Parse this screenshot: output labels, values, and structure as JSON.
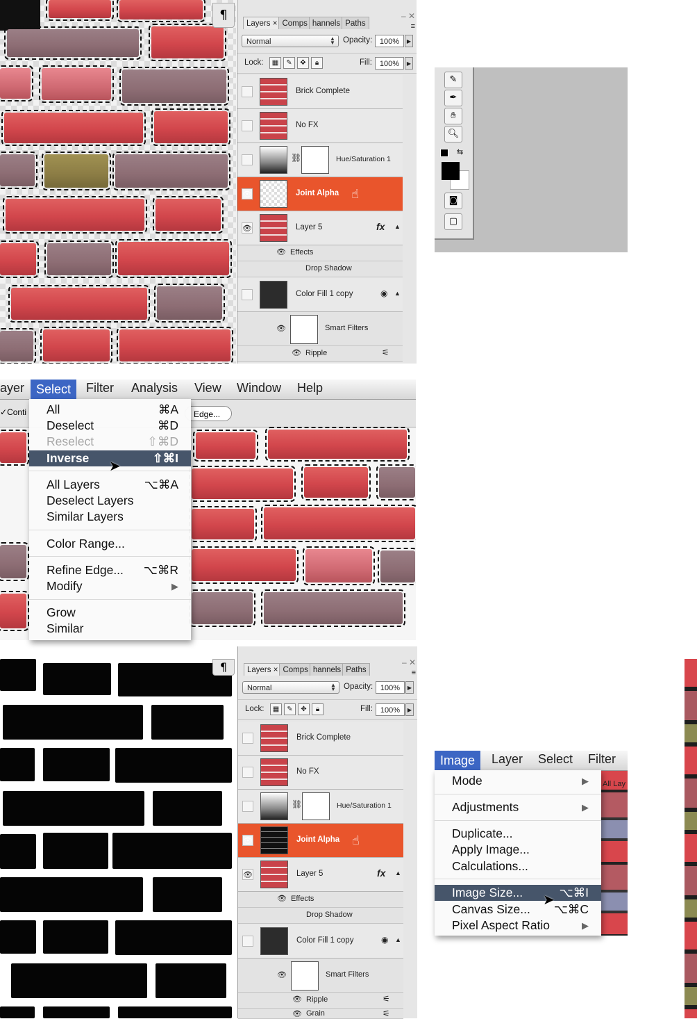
{
  "panel_top": {
    "tabs": [
      "Layers",
      "Comps",
      "hannels",
      "Paths"
    ],
    "tab_close": "×",
    "blend_mode": "Normal",
    "opacity_label": "Opacity:",
    "opacity_value": "100%",
    "lock_label": "Lock:",
    "fill_label": "Fill:",
    "fill_value": "100%",
    "layers": [
      "Brick Complete",
      "No FX",
      "Hue/Saturation 1",
      "Joint Alpha",
      "Layer 5",
      "Color Fill 1 copy"
    ],
    "fx_label": "fx",
    "effects_label": "Effects",
    "drop_shadow_label": "Drop Shadow",
    "smart_filters_label": "Smart Filters",
    "filters": [
      "Ripple"
    ]
  },
  "panel_bottom": {
    "tabs": [
      "Layers",
      "Comps",
      "hannels",
      "Paths"
    ],
    "tab_close": "×",
    "blend_mode": "Normal",
    "opacity_label": "Opacity:",
    "opacity_value": "100%",
    "lock_label": "Lock:",
    "fill_label": "Fill:",
    "fill_value": "100%",
    "layers": [
      "Brick Complete",
      "No FX",
      "Hue/Saturation 1",
      "Joint Alpha",
      "Layer 5",
      "Color Fill 1 copy"
    ],
    "fx_label": "fx",
    "effects_label": "Effects",
    "drop_shadow_label": "Drop Shadow",
    "smart_filters_label": "Smart Filters",
    "filters": [
      "Ripple",
      "Grain"
    ]
  },
  "paragraph_glyph": "¶",
  "select_menu": {
    "menubar": [
      "ayer",
      "Select",
      "Filter",
      "Analysis",
      "View",
      "Window",
      "Help"
    ],
    "options_left": "Conti",
    "refine_button": "Edge...",
    "items": [
      {
        "label": "All",
        "shortcut": "⌘A"
      },
      {
        "label": "Deselect",
        "shortcut": "⌘D"
      },
      {
        "label": "Reselect",
        "shortcut": "⇧⌘D"
      },
      {
        "label": "Inverse",
        "shortcut": "⇧⌘I"
      },
      {
        "label": "All Layers",
        "shortcut": "⌥⌘A"
      },
      {
        "label": "Deselect Layers",
        "shortcut": ""
      },
      {
        "label": "Similar Layers",
        "shortcut": ""
      },
      {
        "label": "Color Range...",
        "shortcut": ""
      },
      {
        "label": "Refine Edge...",
        "shortcut": "⌥⌘R"
      },
      {
        "label": "Modify",
        "shortcut": "▶"
      },
      {
        "label": "Grow",
        "shortcut": ""
      },
      {
        "label": "Similar",
        "shortcut": ""
      }
    ],
    "disabled": [
      "Reselect"
    ],
    "highlighted": "Inverse"
  },
  "image_menu": {
    "menubar": [
      "Image",
      "Layer",
      "Select",
      "Filter"
    ],
    "options_right": "All Lay",
    "items": [
      {
        "label": "Mode",
        "shortcut": "▶"
      },
      {
        "label": "Adjustments",
        "shortcut": "▶"
      },
      {
        "label": "Duplicate...",
        "shortcut": ""
      },
      {
        "label": "Apply Image...",
        "shortcut": ""
      },
      {
        "label": "Calculations...",
        "shortcut": ""
      },
      {
        "label": "Image Size...",
        "shortcut": "⌥⌘I"
      },
      {
        "label": "Canvas Size...",
        "shortcut": "⌥⌘C"
      },
      {
        "label": "Pixel Aspect Ratio",
        "shortcut": "▶"
      }
    ],
    "highlighted": "Image Size..."
  },
  "tools": [
    "notes-tool",
    "eyedropper-tool",
    "hand-tool",
    "zoom-tool",
    "quick-mask",
    "screen-mode"
  ],
  "colors": {
    "selected_layer": "#e9552c",
    "menu_highlight": "#46556a",
    "menubar_highlight": "#3c66c4",
    "brick": "#d2464c"
  }
}
